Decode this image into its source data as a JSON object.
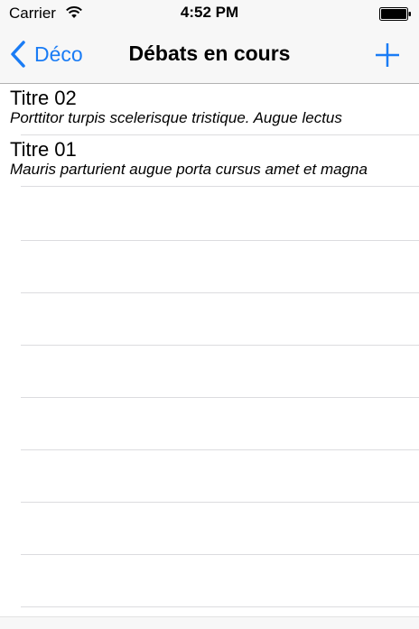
{
  "status": {
    "carrier": "Carrier",
    "time": "4:52 PM",
    "wifi_icon": "wifi-icon",
    "battery_icon": "battery-icon"
  },
  "nav": {
    "back_label": "Déco",
    "title": "Débats en cours",
    "back_icon": "chevron-left-icon",
    "add_icon": "plus-icon"
  },
  "items": [
    {
      "title": "Titre 02",
      "subtitle": "Porttitor turpis scelerisque tristique. Augue lectus"
    },
    {
      "title": "Titre 01",
      "subtitle": "Mauris parturient augue porta cursus amet et magna"
    }
  ],
  "colors": {
    "accent": "#1a7cf5",
    "separator": "#dcdcdf"
  }
}
